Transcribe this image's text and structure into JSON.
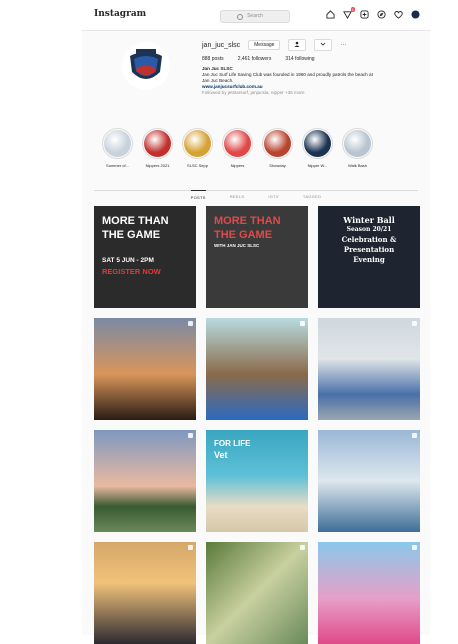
{
  "topbar": {
    "logo": "Instagram",
    "search_placeholder": "Search",
    "notification_count": "1"
  },
  "profile": {
    "username": "jan_juc_slsc",
    "message_label": "Message",
    "more_label": "···",
    "posts": "888 posts",
    "followers": "2,461 followers",
    "following": "314 following",
    "bio_name": "Jan Juc SLSC",
    "bio_line1": "Jan Juc Surf Life Saving Club was founded in 1960 and proudly patrols the beach at",
    "bio_line2": "Jan Juc Beach.",
    "bio_link": "www.janjucsurfclub.com.au",
    "followed_by": "Followed by jetstarsurf, janjucsla, nipper +36 more"
  },
  "highlights": [
    {
      "label": "Summer of...",
      "color": "#c8d2dc"
    },
    {
      "label": "Nippers 2021",
      "color": "#c0312e"
    },
    {
      "label": "SLSC Sepp",
      "color": "#d6a233"
    },
    {
      "label": "Nippers",
      "color": "#e04747"
    },
    {
      "label": "Showday",
      "color": "#b8432f"
    },
    {
      "label": "Nipper W...",
      "color": "#1c3354"
    },
    {
      "label": "Walk Bash",
      "color": "#b8c4d0"
    }
  ],
  "tabs": [
    "POSTS",
    "REELS",
    "IGTV",
    "TAGGED"
  ],
  "posts": [
    {
      "lines": [
        "MORE THAN",
        "THE GAME",
        "SAT 5 JUN - 2PM",
        "REGISTER NOW"
      ],
      "bg": "#2b2b2b"
    },
    {
      "lines": [
        "MORE THAN",
        "THE GAME",
        "WITH JAN JUC SLSC"
      ],
      "bg": "#3a3a3a"
    },
    {
      "lines": [
        "Winter Ball",
        "Season 20/21",
        "Celebration &",
        "Presentation",
        "Evening"
      ],
      "bg": "#1f2530"
    },
    {
      "lines": [],
      "bg": "#8b5a3a"
    },
    {
      "lines": [],
      "bg": "#cfd8df"
    },
    {
      "lines": [],
      "bg": "#8fb4d4"
    },
    {
      "lines": [],
      "bg": "#6d7f9a"
    },
    {
      "lines": [
        "FOR LIFE",
        "Vet"
      ],
      "bg": "#3aa6c0"
    },
    {
      "lines": [],
      "bg": "#7fa0c0"
    },
    {
      "lines": [],
      "bg": "#c79a52"
    },
    {
      "lines": [],
      "bg": "#6d8a4a"
    },
    {
      "lines": [],
      "bg": "#4aa8d8"
    }
  ]
}
